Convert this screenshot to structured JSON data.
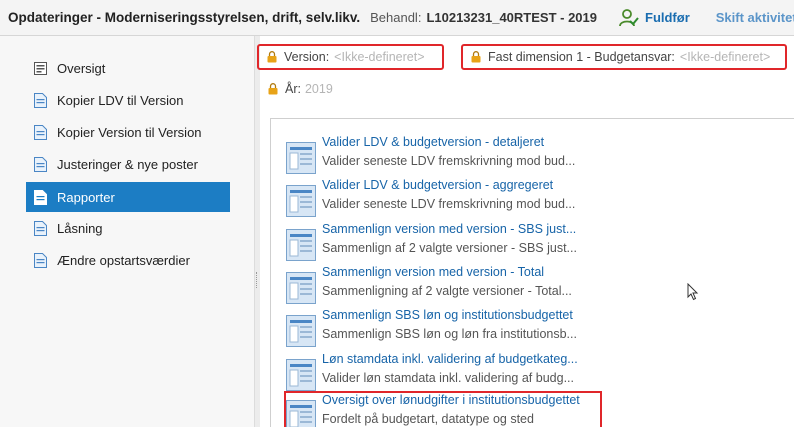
{
  "header": {
    "app_title": "Opdateringer - Moderniseringsstyrelsen, drift, selv.likv.",
    "task_label": "Behandl:",
    "task_value": "L10213231_40RTEST - 2019",
    "complete_label": "Fuldfør",
    "switch_label": "Skift aktiviteter"
  },
  "sidebar": {
    "items": [
      {
        "label": "Oversigt",
        "icon": "overview-icon"
      },
      {
        "label": "Kopier LDV til Version",
        "icon": "document-icon"
      },
      {
        "label": "Kopier Version til Version",
        "icon": "document-icon"
      },
      {
        "label": "Justeringer & nye poster",
        "icon": "document-icon"
      },
      {
        "label": "Rapporter",
        "icon": "document-icon",
        "active": true
      },
      {
        "label": "Låsning",
        "icon": "document-icon"
      },
      {
        "label": "Ændre opstartsværdier",
        "icon": "document-icon"
      }
    ]
  },
  "filters": {
    "version": {
      "label": "Version:",
      "value": "<Ikke-defineret>"
    },
    "dimension": {
      "label": "Fast dimension 1 - Budgetansvar:",
      "value": "<Ikke-defineret>"
    },
    "year": {
      "label": "År:",
      "value": "2019"
    }
  },
  "reports": [
    {
      "title": "Valider LDV & budgetversion - detaljeret",
      "desc": "Valider seneste LDV fremskrivning mod bud..."
    },
    {
      "title": "Valider LDV & budgetversion - aggregeret",
      "desc": "Valider seneste LDV fremskrivning mod bud..."
    },
    {
      "title": "Sammenlign version med version - SBS just...",
      "desc": "Sammenlign af 2 valgte versioner - SBS just..."
    },
    {
      "title": "Sammenlign version med version - Total",
      "desc": "Sammenligning af 2 valgte versioner - Total..."
    },
    {
      "title": "Sammenlign SBS løn og institutionsbudgettet",
      "desc": "Sammenlign SBS løn og løn fra institutionsb..."
    },
    {
      "title": "Løn stamdata inkl. validering af budgetkateg...",
      "desc": "Valider løn stamdata inkl. validering af budg..."
    },
    {
      "title": "Oversigt over lønudgifter i institutionsbudgettet",
      "desc": "Fordelt på budgetart, datatype og sted"
    }
  ],
  "colors": {
    "accent": "#1c7dc4",
    "link": "#1764a8",
    "highlight": "#e0262a",
    "lock": "#e8a317"
  }
}
